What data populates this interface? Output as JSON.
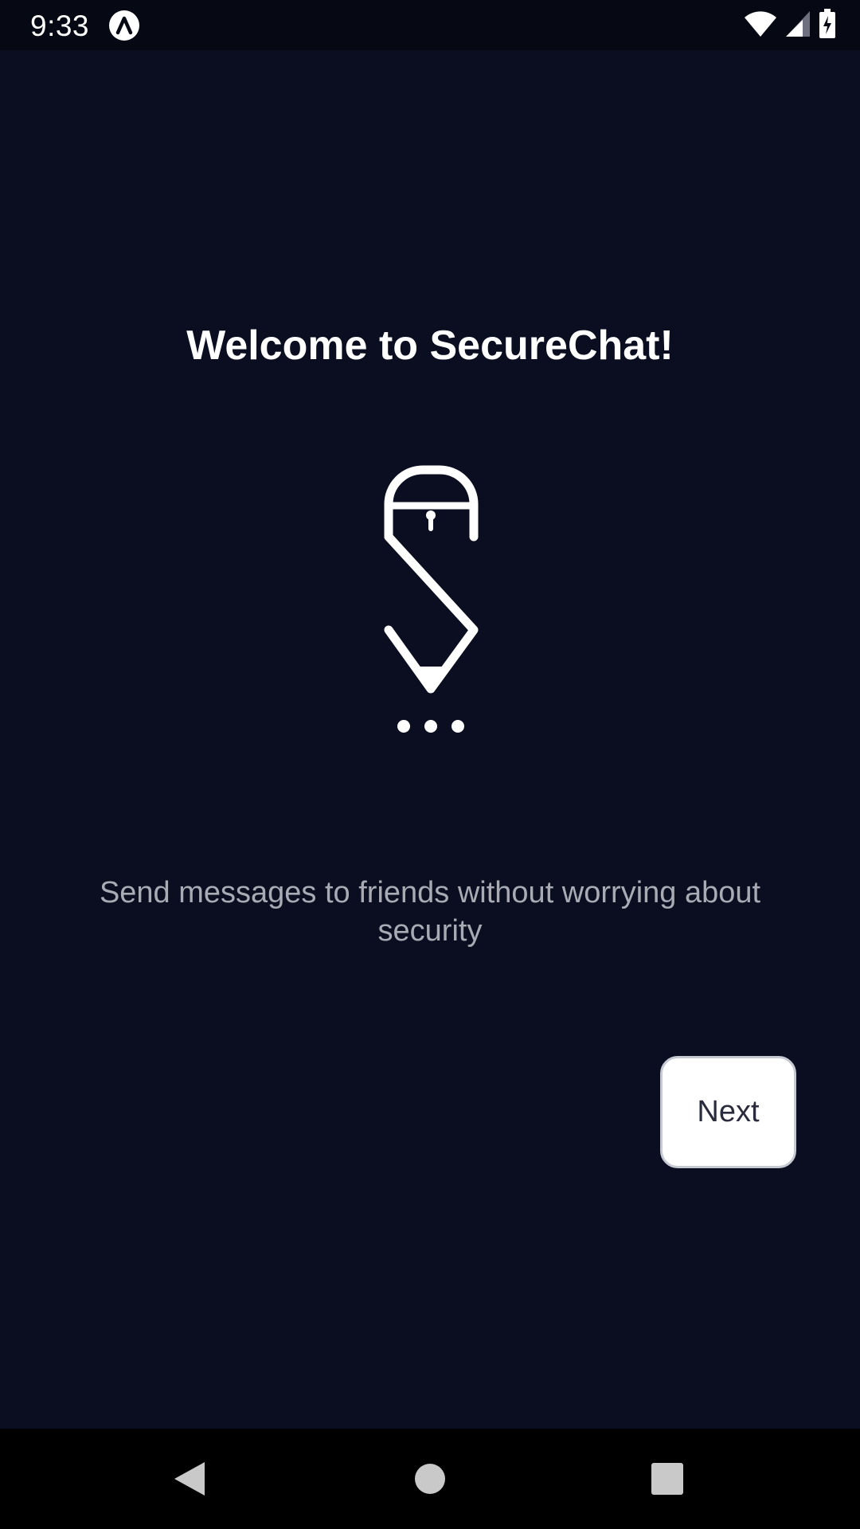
{
  "status_bar": {
    "time": "9:33",
    "app_icon": "lambda-circle-icon",
    "icons": [
      "wifi-icon",
      "cell-signal-icon",
      "battery-charging-icon"
    ]
  },
  "onboarding": {
    "title": "Welcome to SecureChat!",
    "logo_icon": "securechat-lock-pen-logo",
    "description": "Send messages to friends without worrying about security",
    "next_button_label": "Next"
  },
  "nav_bar": {
    "icons": [
      "back-icon",
      "home-icon",
      "recents-icon"
    ]
  },
  "colors": {
    "background": "#0a0e20",
    "status_bar": "#060814",
    "title_text": "#ffffff",
    "description_text": "#a9abb4",
    "button_background": "#ffffff",
    "button_text": "#2a2c3d"
  }
}
